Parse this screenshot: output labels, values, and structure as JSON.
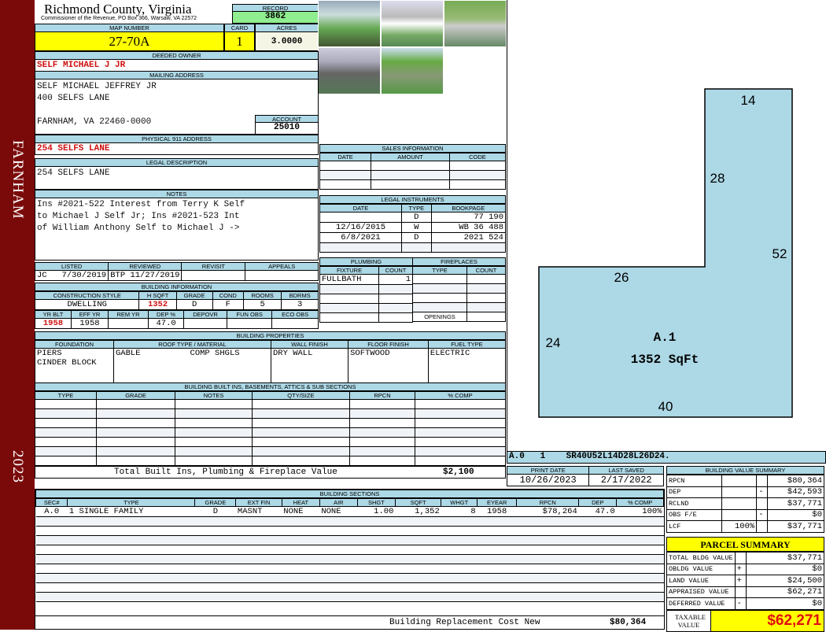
{
  "sidebar": {
    "town": "FARNHAM",
    "year": "2023"
  },
  "header": {
    "county": "Richmond County, Virginia",
    "office": "Commissioner of the Revenue, PO Box 366, Warsaw, VA 22572",
    "record_label": "RECORD",
    "record": "3862"
  },
  "parcel": {
    "map_label": "MAP NUMBER",
    "map": "27-70A",
    "card_label": "CARD",
    "card": "1",
    "acres_label": "ACRES",
    "acres": "3.0000"
  },
  "owner": {
    "label": "DEEDED OWNER",
    "name": "SELF MICHAEL J JR",
    "mail_label": "MAILING ADDRESS",
    "mail1": "SELF MICHAEL JEFFREY JR",
    "mail2": "400 SELFS LANE",
    "mail3": "FARNHAM, VA 22460-0000",
    "account_label": "ACCOUNT",
    "account": "25010"
  },
  "address": {
    "label": "PHYSICAL 911 ADDRESS",
    "value": "254 SELFS LANE"
  },
  "legal": {
    "label": "LEGAL DESCRIPTION",
    "value": "254 SELFS LANE"
  },
  "notes": {
    "label": "NOTES",
    "lines": [
      "Ins #2021-522 Interest from Terry K Self",
      "to Michael J Self Jr; Ins #2021-523 Int",
      "of William Anthony Self to Michael J ->"
    ]
  },
  "listing": {
    "headers": [
      "LISTED",
      "REVIEWED",
      "REVISIT",
      "APPEALS"
    ],
    "listed_by": "JC",
    "listed": "7/30/2019",
    "reviewed_by": "BTP",
    "reviewed": "11/27/2019"
  },
  "building_info": {
    "title": "BUILDING INFORMATION",
    "h1": [
      "CONSTRUCTION STYLE",
      "H SQFT",
      "GRADE",
      "COND",
      "ROOMS",
      "BDRMS"
    ],
    "v1": [
      "DWELLING",
      "1352",
      "D",
      "F",
      "5",
      "3"
    ],
    "h2": [
      "YR BLT",
      "EFF YR",
      "REM YR",
      "DEP %",
      "DEPOVR",
      "FUN OBS",
      "ECO OBS"
    ],
    "v2": [
      "1958",
      "1958",
      "",
      "47.0",
      "",
      "",
      ""
    ]
  },
  "sales": {
    "title": "SALES INFORMATION",
    "headers": [
      "DATE",
      "AMOUNT",
      "CODE"
    ]
  },
  "instruments": {
    "title": "LEGAL INSTRUMENTS",
    "headers": [
      "DATE",
      "TYPE",
      "BOOKPAGE"
    ],
    "rows": [
      [
        "",
        "D",
        "77 190"
      ],
      [
        "12/16/2015",
        "W",
        "WB 36 488"
      ],
      [
        "6/8/2021",
        "D",
        "2021 524"
      ]
    ]
  },
  "plumbing": {
    "title": "PLUMBING",
    "headers": [
      "FIXTURE",
      "COUNT"
    ],
    "rows": [
      [
        "FULLBATH",
        "1"
      ]
    ]
  },
  "fireplaces": {
    "title": "FIREPLACES",
    "headers": [
      "TYPE",
      "COUNT"
    ],
    "openings": "OPENINGS"
  },
  "properties": {
    "title": "BUILDING PROPERTIES",
    "headers": [
      "FOUNDATION",
      "ROOF TYPE / MATERIAL",
      "WALL FINISH",
      "FLOOR FINISH",
      "FUEL TYPE"
    ],
    "foundation": [
      "PIERS",
      "CINDER BLOCK"
    ],
    "roof_type": "GABLE",
    "roof_material": "COMP SHGLS",
    "wall": "DRY WALL",
    "floor": "SOFTWOOD",
    "fuel": "ELECTRIC"
  },
  "builtins": {
    "title": "BUILDING BUILT INS, BASEMENTS, ATTICS & SUB SECTIONS",
    "headers": [
      "TYPE",
      "GRADE",
      "NOTES",
      "QTY/SIZE",
      "RPCN",
      "% COMP"
    ],
    "total_label": "Total Built Ins, Plumbing & Fireplace Value",
    "total": "$2,100"
  },
  "sketch": {
    "labels": [
      "14",
      "28",
      "52",
      "26",
      "24",
      "40"
    ],
    "area_name": "A.1",
    "area": "1352 SqFt",
    "code": "A.0   1    SR40U52L14D28L26D24.",
    "fill": "#add8e6"
  },
  "dates": {
    "print_label": "PRINT DATE",
    "print": "10/26/2023",
    "saved_label": "LAST SAVED",
    "saved": "2/17/2022"
  },
  "sections": {
    "title": "BUILDING SECTIONS",
    "headers": [
      "SEC#",
      "TYPE",
      "GRADE",
      "EXT FIN",
      "HEAT",
      "AIR",
      "SHGT",
      "SQFT",
      "WHGT",
      "EYEAR",
      "RPCN",
      "DEP",
      "% COMP"
    ],
    "rows": [
      [
        "A.0",
        "1 SINGLE FAMILY",
        "D",
        "MASNT",
        "NONE",
        "NONE",
        "1.00",
        "1,352",
        "8",
        "1958",
        "$78,264",
        "47.0",
        "100%"
      ]
    ],
    "replacement_label": "Building Replacement Cost New",
    "replacement": "$80,364"
  },
  "value_summary": {
    "title": "BUILDING VALUE SUMMARY",
    "rows": [
      [
        "RPCN",
        "",
        "",
        "$80,364"
      ],
      [
        "DEP",
        "",
        "-",
        "$42,593"
      ],
      [
        "RCLND",
        "",
        "",
        "$37,771"
      ],
      [
        "OBS F/E",
        "",
        "-",
        "$0"
      ],
      [
        "LCF",
        "100%",
        "",
        "$37,771"
      ]
    ]
  },
  "parcel_summary": {
    "title": "PARCEL SUMMARY",
    "rows": [
      [
        "TOTAL BLDG VALUE",
        "",
        "$37,771"
      ],
      [
        "OBLDG VALUE",
        "+",
        "$0"
      ],
      [
        "LAND VALUE",
        "+",
        "$24,500"
      ],
      [
        "APPRAISED VALUE",
        "",
        "$62,271"
      ],
      [
        "DEFERRED VALUE",
        "-",
        "$0"
      ]
    ],
    "taxable_label": "TAXABLE VALUE",
    "taxable": "$62,271"
  }
}
